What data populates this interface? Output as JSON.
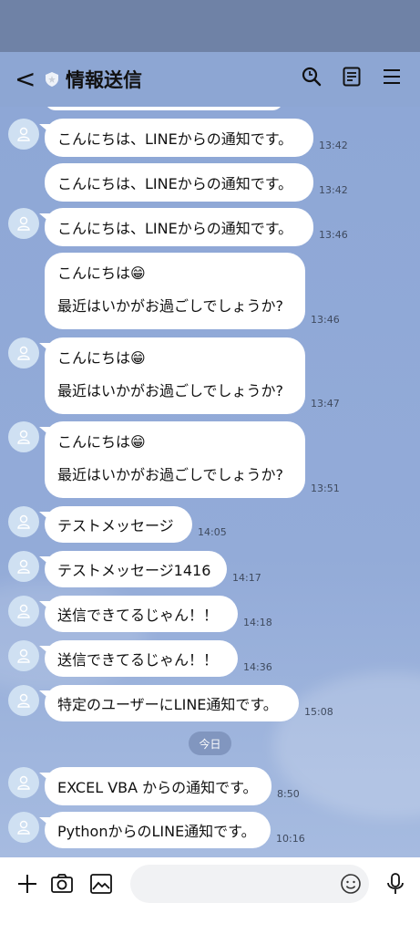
{
  "header": {
    "title": "情報送信",
    "back_label": "<",
    "icons": [
      "back-icon",
      "shield-icon",
      "search-icon",
      "notes-icon",
      "menu-icon"
    ]
  },
  "messages": [
    {
      "text": "こんにちは、LINEからの通知です。",
      "time": "13:42"
    },
    {
      "text": "こんにちは、LINEからの通知です。",
      "time": "13:42"
    },
    {
      "text": "こんにちは、LINEからの通知です。",
      "time": "13:46"
    },
    {
      "line1": "こんにちは😁",
      "line2": "最近はいかがお過ごしでしょうか?",
      "time": "13:46"
    },
    {
      "line1": "こんにちは😁",
      "line2": "最近はいかがお過ごしでしょうか?",
      "time": "13:47"
    },
    {
      "line1": "こんにちは😁",
      "line2": "最近はいかがお過ごしでしょうか?",
      "time": "13:51"
    },
    {
      "text": "テストメッセージ",
      "time": "14:05"
    },
    {
      "text": "テストメッセージ1416",
      "time": "14:17"
    },
    {
      "text": "送信できてるじゃん！！",
      "time": "14:18"
    },
    {
      "text": "送信できてるじゃん！！",
      "time": "14:36"
    },
    {
      "text": "特定のユーザーにLINE通知です。",
      "time": "15:08"
    },
    {
      "text": "EXCEL VBA からの通知です。",
      "time": "8:50"
    },
    {
      "text": "PythonからのLINE通知です。",
      "time": "10:16"
    }
  ],
  "date_separator": "今日",
  "input": {
    "placeholder": "",
    "icons": [
      "plus-icon",
      "camera-icon",
      "image-icon",
      "emoji-icon",
      "mic-icon"
    ]
  },
  "colors": {
    "chat_background": "#8ea7d6",
    "header_background": "#8da6d3",
    "status_bar": "#6f82a6",
    "bubble": "#ffffff",
    "date_pill": "#8196bf"
  }
}
